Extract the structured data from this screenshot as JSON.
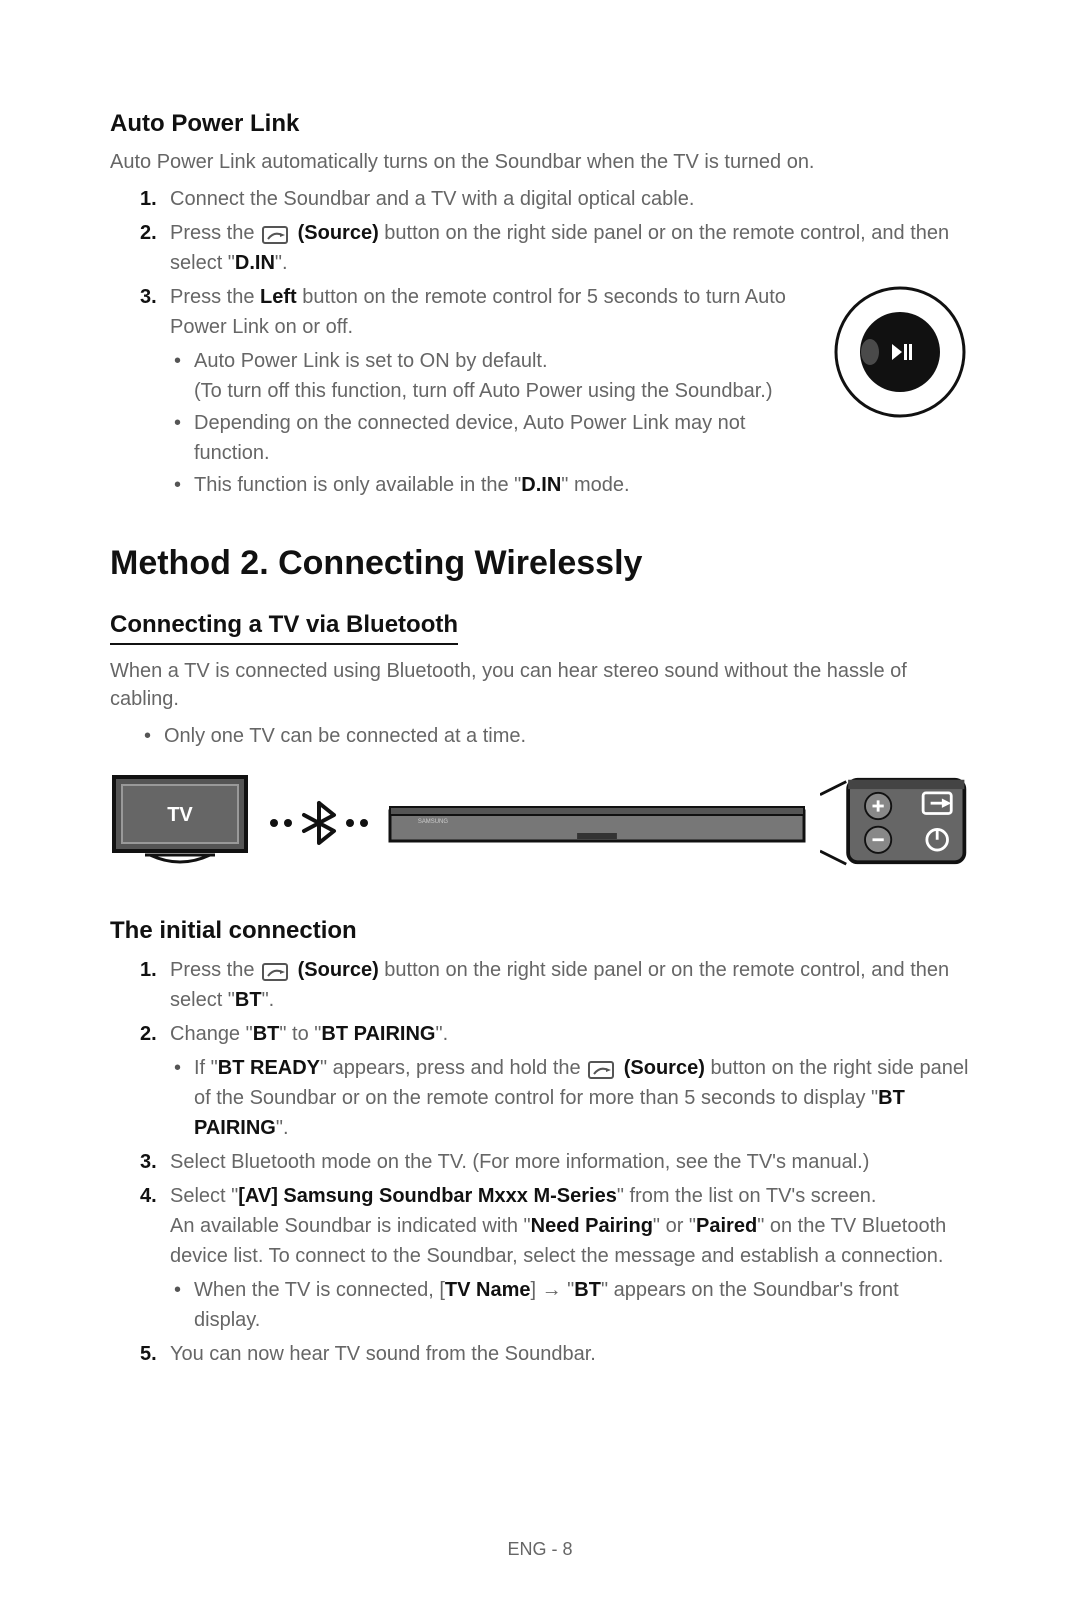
{
  "section1": {
    "title": "Auto Power Link",
    "intro": "Auto Power Link automatically turns on the Soundbar when the TV is turned on.",
    "step1_num": "1.",
    "step1": "Connect the Soundbar and a TV with a digital optical cable.",
    "step2_num": "2.",
    "step2_pre": "Press the ",
    "step2_source_label": " (Source)",
    "step2_mid": " button on the right side panel or on the remote control, and then select \"",
    "step2_bold": "D.IN",
    "step2_post": "\".",
    "step3_num": "3.",
    "step3_pre": "Press the ",
    "step3_left": "Left",
    "step3_post": " button on the remote control for 5 seconds to turn Auto Power Link on or off.",
    "bullet1_a": "Auto Power Link is set to ON by default.",
    "bullet1_b": "(To turn off this function, turn off Auto Power using the Soundbar.)",
    "bullet2": "Depending on the connected device, Auto Power Link may not function.",
    "bullet3_pre": "This function is only available in the \"",
    "bullet3_bold": "D.IN",
    "bullet3_post": "\" mode."
  },
  "method2": {
    "title": "Method 2. Connecting Wirelessly",
    "subtitle": "Connecting a TV via Bluetooth",
    "intro": "When a TV is connected using Bluetooth, you can hear stereo sound without the hassle of cabling.",
    "bullet": "Only one TV can be connected at a time."
  },
  "diagram": {
    "tv_label": "TV"
  },
  "initial": {
    "title": "The initial connection",
    "step1_num": "1.",
    "step1_pre": "Press the ",
    "step1_source": " (Source)",
    "step1_mid": " button on the right side panel or on the remote control, and then select \"",
    "step1_bold": "BT",
    "step1_post": "\".",
    "step2_num": "2.",
    "step2_pre": "Change \"",
    "step2_bt": "BT",
    "step2_mid": "\" to \"",
    "step2_pair": "BT PAIRING",
    "step2_post": "\".",
    "step2_sub_pre": "If \"",
    "step2_sub_ready": "BT READY",
    "step2_sub_mid1": "\" appears, press and hold the ",
    "step2_sub_source": " (Source)",
    "step2_sub_mid2": " button on the right side panel of the Soundbar or on the remote control for more than 5 seconds to display \"",
    "step2_sub_pair": "BT PAIRING",
    "step2_sub_post": "\".",
    "step3_num": "3.",
    "step3": "Select Bluetooth mode on the TV. (For more information, see the TV's manual.)",
    "step4_num": "4.",
    "step4_pre": "Select \"",
    "step4_bold": "[AV] Samsung Soundbar Mxxx M-Series",
    "step4_mid": "\" from the list on TV's screen.",
    "step4_line2_pre": "An available Soundbar is indicated with \"",
    "step4_need": "Need Pairing",
    "step4_or": "\" or \"",
    "step4_paired": "Paired",
    "step4_line2_post": "\" on the TV Bluetooth device list. To connect to the Soundbar, select the message and establish a connection.",
    "step4_sub_pre": "When the TV is connected, [",
    "step4_sub_tvname": "TV Name",
    "step4_sub_arrow": "] → \"",
    "step4_sub_bt": "BT",
    "step4_sub_post": "\" appears on the Soundbar's front display.",
    "step5_num": "5.",
    "step5": "You can now hear TV sound from the Soundbar."
  },
  "footer": {
    "page": "ENG - 8"
  },
  "icons": {
    "source": "source-icon",
    "play_pause": "play-pause-icon",
    "bluetooth": "bluetooth-icon",
    "plus": "plus-icon",
    "minus": "minus-icon",
    "power": "power-icon",
    "input": "input-icon"
  }
}
